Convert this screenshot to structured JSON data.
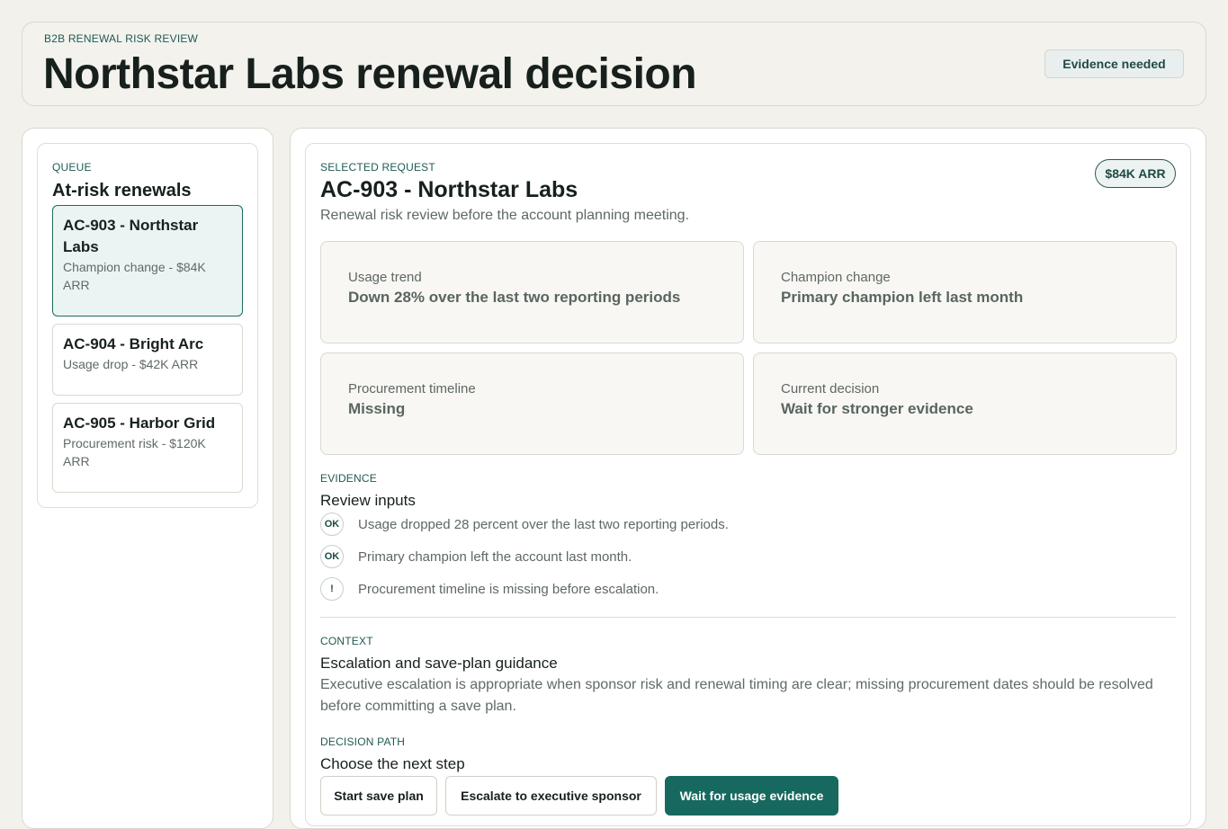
{
  "header": {
    "eyebrow": "B2B RENEWAL RISK REVIEW",
    "title": "Northstar Labs renewal decision",
    "status_badge": "Evidence needed"
  },
  "queue": {
    "eyebrow": "QUEUE",
    "title": "At-risk renewals",
    "items": [
      {
        "title": "AC-903 - Northstar Labs",
        "subtitle": "Champion change - $84K ARR",
        "selected": true
      },
      {
        "title": "AC-904 - Bright Arc",
        "subtitle": "Usage drop - $42K ARR",
        "selected": false
      },
      {
        "title": "AC-905 - Harbor Grid",
        "subtitle": "Procurement risk - $120K ARR",
        "selected": false
      }
    ]
  },
  "request": {
    "eyebrow": "SELECTED REQUEST",
    "title": "AC-903 - Northstar Labs",
    "description": "Renewal risk review before the account planning meeting.",
    "arr_badge": "$84K ARR",
    "metrics": [
      {
        "label": "Usage trend",
        "value": "Down 28% over the last two reporting periods"
      },
      {
        "label": "Champion change",
        "value": "Primary champion left last month"
      },
      {
        "label": "Procurement timeline",
        "value": "Missing"
      },
      {
        "label": "Current decision",
        "value": "Wait for stronger evidence"
      }
    ]
  },
  "evidence": {
    "eyebrow": "EVIDENCE",
    "title": "Review inputs",
    "items": [
      {
        "mark": "OK",
        "text": "Usage dropped 28 percent over the last two reporting periods."
      },
      {
        "mark": "OK",
        "text": "Primary champion left the account last month."
      },
      {
        "mark": "!",
        "text": "Procurement timeline is missing before escalation."
      }
    ]
  },
  "context": {
    "eyebrow": "CONTEXT",
    "title": "Escalation and save-plan guidance",
    "text": "Executive escalation is appropriate when sponsor risk and renewal timing are clear; missing procurement dates should be resolved before committing a save plan."
  },
  "decision": {
    "eyebrow": "DECISION PATH",
    "title": "Choose the next step",
    "options": [
      {
        "label": "Start save plan"
      },
      {
        "label": "Escalate to executive sponsor"
      },
      {
        "label": "Wait for usage evidence",
        "selected": true
      }
    ]
  },
  "colors": {
    "accent": "#17695f",
    "page_background": "#f2f1ec",
    "selected_item_background": "#eaf4f2"
  }
}
